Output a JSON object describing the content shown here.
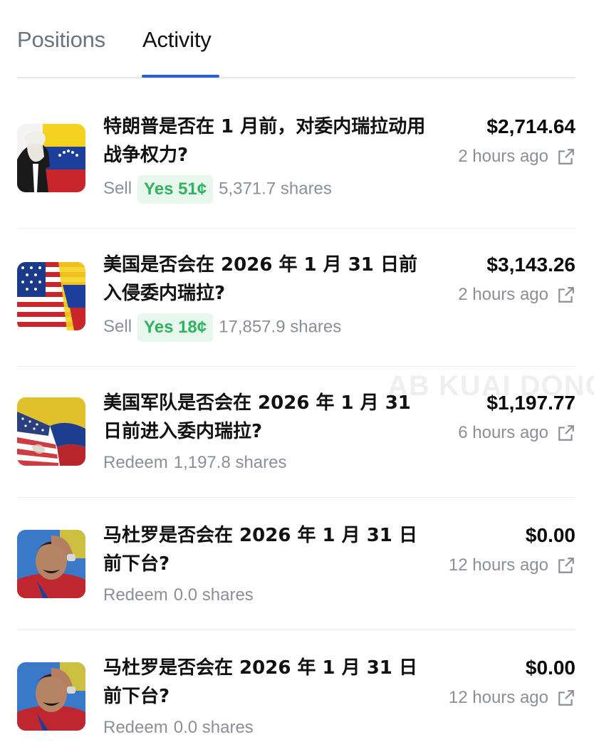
{
  "tabs": [
    {
      "label": "Positions",
      "active": false
    },
    {
      "label": "Activity",
      "active": true
    }
  ],
  "activity": [
    {
      "title": "特朗普是否在 1 月前，对委内瑞拉动用战争权力?",
      "action": "Sell",
      "outcome": "Yes 51¢",
      "shares": "5,371.7 shares",
      "amount": "$2,714.64",
      "time": "2 hours ago",
      "thumb": "trump-venezuela-flag"
    },
    {
      "title": "美国是否会在 2026 年 1 月 31 日前入侵委内瑞拉?",
      "action": "Sell",
      "outcome": "Yes 18¢",
      "shares": "17,857.9 shares",
      "amount": "$3,143.26",
      "time": "2 hours ago",
      "thumb": "us-venezuela-flags"
    },
    {
      "title": "美国军队是否会在 2026 年 1 月 31 日前进入委内瑞拉?",
      "action": "Redeem",
      "outcome": "",
      "shares": "1,197.8 shares",
      "amount": "$1,197.77",
      "time": "6 hours ago",
      "thumb": "us-venezuela-wall-flags"
    },
    {
      "title": "马杜罗是否会在 2026 年 1 月 31 日前下台?",
      "action": "Redeem",
      "outcome": "",
      "shares": "0.0 shares",
      "amount": "$0.00",
      "time": "12 hours ago",
      "thumb": "maduro-photo"
    },
    {
      "title": "马杜罗是否会在 2026 年 1 月 31 日前下台?",
      "action": "Redeem",
      "outcome": "",
      "shares": "0.0 shares",
      "amount": "$0.00",
      "time": "12 hours ago",
      "thumb": "maduro-photo"
    }
  ],
  "watermark": "AB KUAI DONG",
  "colors": {
    "accent_tab": "#1f5fe0",
    "yes_green": "#2fb35e",
    "yes_bg": "#e8f7ee",
    "muted": "#8b8f97"
  }
}
